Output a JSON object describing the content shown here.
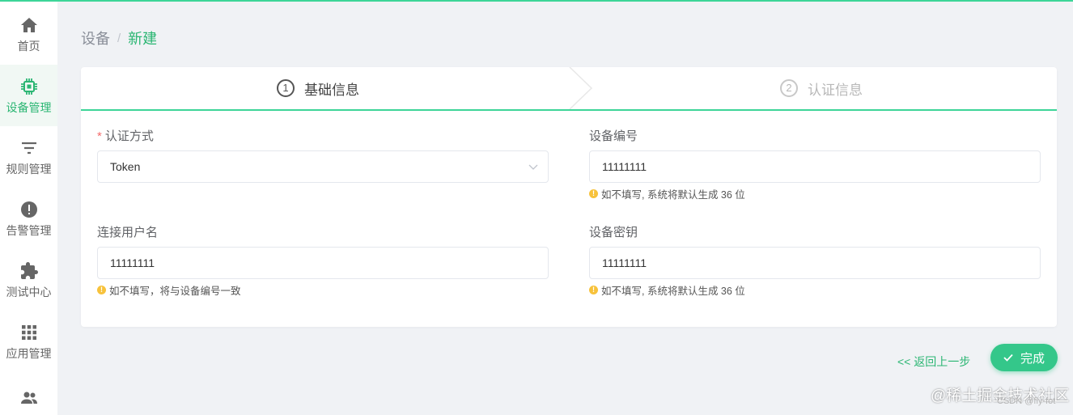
{
  "sidebar": {
    "items": [
      {
        "label": "首页",
        "icon": "home-icon"
      },
      {
        "label": "设备管理",
        "icon": "chip-icon",
        "active": true
      },
      {
        "label": "规则管理",
        "icon": "filter-icon"
      },
      {
        "label": "告警管理",
        "icon": "alert-icon"
      },
      {
        "label": "测试中心",
        "icon": "puzzle-icon"
      },
      {
        "label": "应用管理",
        "icon": "apps-grid-icon"
      },
      {
        "label": "",
        "icon": "users-icon"
      }
    ]
  },
  "breadcrumb": {
    "root": "设备",
    "sep": "/",
    "current": "新建"
  },
  "steps": [
    {
      "num": "1",
      "label": "基础信息",
      "active": true
    },
    {
      "num": "2",
      "label": "认证信息",
      "active": false
    }
  ],
  "form": {
    "auth_method": {
      "label": "认证方式",
      "required": "*",
      "value": "Token"
    },
    "device_id": {
      "label": "设备编号",
      "value": "11111111",
      "hint": "如不填写, 系统将默认生成 36 位"
    },
    "username": {
      "label": "连接用户名",
      "value": "11111111",
      "hint": "如不填写，将与设备编号一致"
    },
    "device_secret": {
      "label": "设备密钥",
      "value": "11111111",
      "hint": "如不填写, 系统将默认生成 36 位"
    }
  },
  "actions": {
    "back": "<< 返回上一步",
    "done": "完成"
  },
  "watermark": {
    "main": "@稀土掘金技术社区",
    "sub": "CSDN @fly-fot"
  },
  "colors": {
    "accent": "#2bb673",
    "accent_bright": "#3dd598",
    "warning": "#f7c23b",
    "required": "#f56c6c"
  }
}
